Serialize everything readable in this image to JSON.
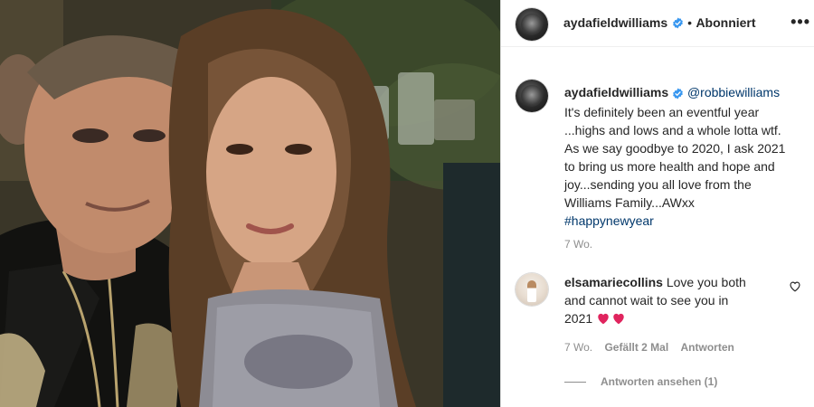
{
  "post": {
    "author": "aydafieldwilliams",
    "follow_status": "Abonniert",
    "more_icon": "more-horizontal-icon",
    "separator": "•"
  },
  "caption": {
    "author": "aydafieldwilliams",
    "mention": "@robbiewilliams",
    "lines": [
      "It's definitely been an eventful year",
      "...highs and lows and a whole lotta wtf.",
      "As we say goodbye to 2020, I ask 2021",
      "to bring us more health and hope and",
      "joy...sending you all love from the",
      "Williams Family...AWxx"
    ],
    "hashtag": "#happynewyear",
    "age": "7 Wo."
  },
  "comment": {
    "author": "elsamariecollins",
    "text_lines": [
      "Love you both",
      "and cannot wait to see you in",
      "2021"
    ],
    "emoji": "❤️❤️",
    "age": "7 Wo.",
    "likes": "Gefällt 2 Mal",
    "reply": "Antworten",
    "view_replies": "Antworten ansehen (1)"
  },
  "colors": {
    "verified_blue": "#3897f0",
    "link_blue": "#00376b",
    "muted_gray": "#8e8e8e",
    "heart_red": "#e0245e"
  }
}
